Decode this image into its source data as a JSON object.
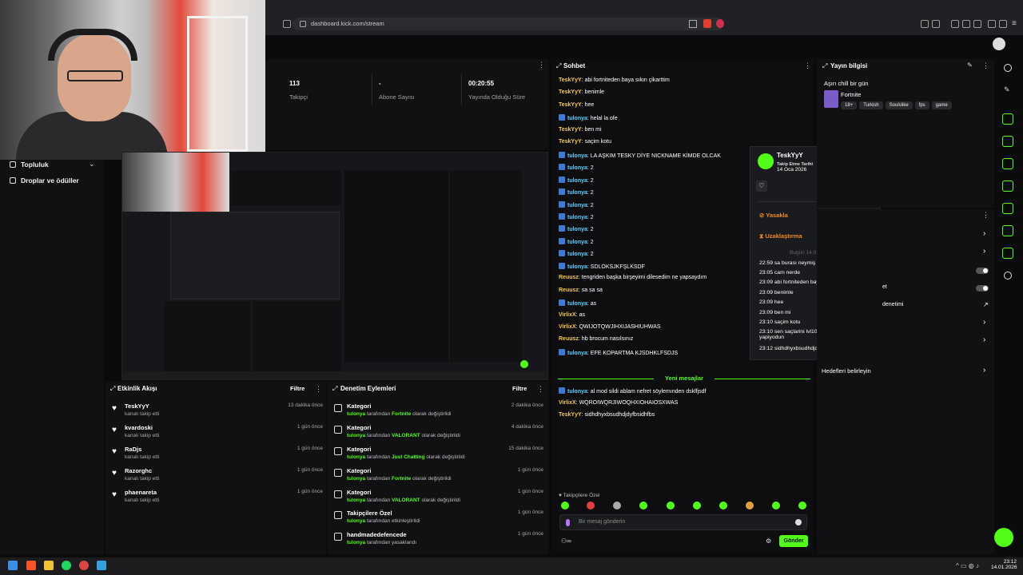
{
  "browser": {
    "url": "dashboard.kick.com/stream"
  },
  "sidebar": {
    "items": [
      {
        "label": "Topluluk"
      },
      {
        "label": "Droplar ve ödüller"
      }
    ]
  },
  "stats": [
    {
      "value": "113",
      "label": "Takipçi"
    },
    {
      "value": "-",
      "label": "Abone Sayısı"
    },
    {
      "value": "00:20:55",
      "label": "Yayında Olduğu Süre"
    }
  ],
  "activity": {
    "title": "Etkinlik Akışı",
    "filter": "Filtre",
    "items": [
      {
        "name": "TeskYyY",
        "sub": "kanalı takip etti",
        "time": "13 dakika önce"
      },
      {
        "name": "kvardoski",
        "sub": "kanalı takip etti",
        "time": "1 gün önce"
      },
      {
        "name": "RaDjs",
        "sub": "kanalı takip etti",
        "time": "1 gün önce"
      },
      {
        "name": "Razorghc",
        "sub": "kanalı takip etti",
        "time": "1 gün önce"
      },
      {
        "name": "phaenareta",
        "sub": "kanalı takip etti",
        "time": "1 gün önce"
      }
    ]
  },
  "mod": {
    "title": "Denetim Eylemleri",
    "filter": "Filtre",
    "items": [
      {
        "name": "Kategori",
        "user": "tulonya",
        "pre": "tarafından",
        "hl": "Fortnite",
        "post": "olarak değiştirildi",
        "time": "2 dakika önce"
      },
      {
        "name": "Kategori",
        "user": "tulonya",
        "pre": "tarafından",
        "hl": "VALORANT",
        "post": "olarak değiştirildi",
        "time": "4 dakika önce"
      },
      {
        "name": "Kategori",
        "user": "tulonya",
        "pre": "tarafından",
        "hl": "Just Chatting",
        "post": "olarak değiştirildi",
        "time": "15 dakika önce"
      },
      {
        "name": "Kategori",
        "user": "tulonya",
        "pre": "tarafından",
        "hl": "Fortnite",
        "post": "olarak değiştirildi",
        "time": "1 gün önce"
      },
      {
        "name": "Kategori",
        "user": "tulonya",
        "pre": "tarafından",
        "hl": "VALORANT",
        "post": "olarak değiştirildi",
        "time": "1 gün önce"
      },
      {
        "name": "Takipçilere Özel",
        "user": "tulonya",
        "pre": "tarafından etkinleştirildi",
        "hl": "",
        "post": "",
        "time": "1 gün önce"
      },
      {
        "name": "handmadedefencede",
        "user": "tulonya",
        "pre": "tarafından yasaklandı",
        "hl": "",
        "post": "",
        "time": "1 gün önce"
      }
    ]
  },
  "chat": {
    "title": "Sohbet",
    "new_messages": "Yeni mesajlar",
    "followers_only": "Takipçilere Özel",
    "placeholder": "Bir mesaj gönderin",
    "send": "Gönder",
    "lines": [
      {
        "user": "TeskYyY",
        "cls": "n-tesk",
        "msg": "abi fortniteden baya sıkın çikarttim",
        "badge": false
      },
      {
        "user": "TeskYyY",
        "cls": "n-tesk",
        "msg": "benimle",
        "badge": false
      },
      {
        "user": "TeskYyY",
        "cls": "n-tesk",
        "msg": "hee",
        "badge": false
      },
      {
        "user": "tulonya",
        "cls": "n-tul",
        "msg": "helal la ofe",
        "badge": true
      },
      {
        "user": "TeskYyY",
        "cls": "n-tesk",
        "msg": "ben mi",
        "badge": false
      },
      {
        "user": "TeskYyY",
        "cls": "n-tesk",
        "msg": "saçim kotu",
        "badge": false
      },
      {
        "user": "tulonya",
        "cls": "n-tul",
        "msg": "LA AŞKIM TESKY DİYE NICKNAME KİMDE OLCAK",
        "badge": true
      },
      {
        "user": "tulonya",
        "cls": "n-tul",
        "msg": "2",
        "badge": true
      },
      {
        "user": "tulonya",
        "cls": "n-tul",
        "msg": "2",
        "badge": true
      },
      {
        "user": "tulonya",
        "cls": "n-tul",
        "msg": "2",
        "badge": true
      },
      {
        "user": "tulonya",
        "cls": "n-tul",
        "msg": "2",
        "badge": true
      },
      {
        "user": "tulonya",
        "cls": "n-tul",
        "msg": "2",
        "badge": true
      },
      {
        "user": "tulonya",
        "cls": "n-tul",
        "msg": "2",
        "badge": true
      },
      {
        "user": "tulonya",
        "cls": "n-tul",
        "msg": "2",
        "badge": true
      },
      {
        "user": "tulonya",
        "cls": "n-tul",
        "msg": "2",
        "badge": true
      },
      {
        "user": "tulonya",
        "cls": "n-tul",
        "msg": "SDLOKSJKFŞLKSDF",
        "badge": true
      },
      {
        "user": "Reuusz",
        "cls": "n-reu",
        "msg": "tengriden başka birşeyimi dilesedim ne yapsaydım",
        "badge": false
      },
      {
        "user": "Reuusz",
        "cls": "n-reu",
        "msg": "sa sa sa",
        "badge": false
      },
      {
        "user": "tulonya",
        "cls": "n-tul",
        "msg": "as",
        "badge": true
      },
      {
        "user": "VirlixX",
        "cls": "n-vir",
        "msg": "as",
        "badge": false
      },
      {
        "user": "VirlixX",
        "cls": "n-vir",
        "msg": "QWIJOTQWJIHXIJASHIUHWAS",
        "badge": false
      },
      {
        "user": "Reuusz",
        "cls": "n-reu",
        "msg": "hb brocum nasılsınız",
        "badge": false
      },
      {
        "user": "tulonya",
        "cls": "n-tul",
        "msg": "EFE KOPARTMA KJSDHKLFSDJS",
        "badge": true
      }
    ],
    "new_lines": [
      {
        "user": "tulonya",
        "cls": "n-tul",
        "msg": "al mod sildi ablam nefret söylemınden dsklfjsdf",
        "badge": true
      },
      {
        "user": "VirlixX",
        "cls": "n-vir",
        "msg": "WQROIWQRJIWOQHXIOHAIOSXWAS",
        "badge": false
      },
      {
        "user": "TeskYyY",
        "cls": "n-tesk",
        "msg": "sidhdhyxbsudhdjdyfbsidhfbs",
        "badge": false
      }
    ]
  },
  "usercard": {
    "name": "TeskYyY",
    "follow_label": "Takip Etme Tarihi",
    "follow_date": "14 Oca 2026",
    "ban": "Yasakla",
    "timeout": "Uzaklaştırma",
    "date_sep": "Bugün 14.01.2026",
    "history": [
      "22:59 sa burası neymiş la böyle",
      "23:05 cam nerde",
      "23:09 abi fortniteden baya sıkın çikarttim",
      "23:09 benimle",
      "23:09 hee",
      "23:09 ben mi",
      "23:10 saçim kotu",
      "23:10 sen saçlarini lvl100 Suriyeli gibi yapiyodun",
      "23:12 sidhdhyxbsudhdjdyfbsidhfbs"
    ]
  },
  "info": {
    "title": "Yayın bilgisi",
    "stream_title": "Aşırı chill bir gün",
    "category": "Fortnite",
    "tags": [
      "18+",
      "Turkish",
      "Soulslike",
      "fps",
      "game"
    ],
    "frag1": "et",
    "frag2": "denetimi",
    "goals": "Hedefleri belirleyin"
  },
  "clock": {
    "time": "23:12",
    "date": "14.01.2026"
  }
}
